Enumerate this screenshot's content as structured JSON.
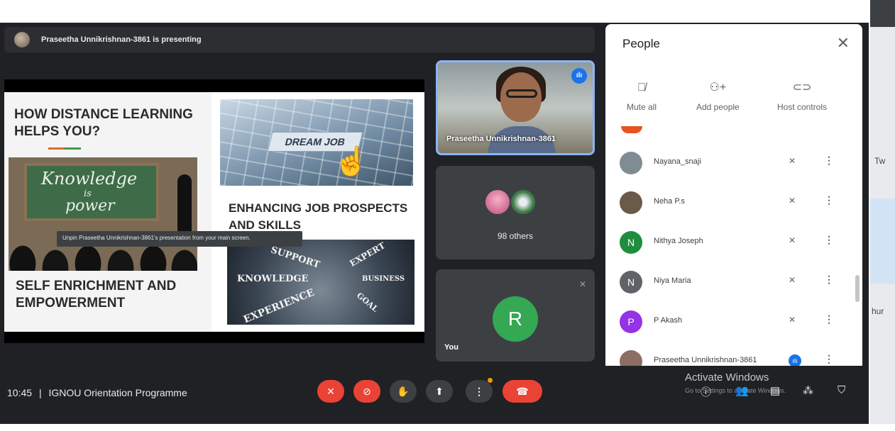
{
  "presenter_bar": {
    "text": "Praseetha Unnikrishnan-3861 is presenting"
  },
  "slide": {
    "heading_1": "HOW DISTANCE LEARNING HELPS YOU?",
    "board_word_1": "Knowledge",
    "board_word_2": "is",
    "board_word_3": "power",
    "heading_2": "SELF ENRICHMENT AND EMPOWERMENT",
    "keyboard_key": "DREAM JOB",
    "heading_3": "ENHANCING JOB PROSPECTS AND SKILLS",
    "biz_words": [
      "SUPPORT",
      "EXPERT",
      "KNOWLEDGE",
      "BUSINESS",
      "EXPERIENCE",
      "GOAL"
    ]
  },
  "tooltip": "Unpin Praseetha Unnikrishnan-3861's presentation from your main screen.",
  "tiles": {
    "presenter_name": "Praseetha Unnikrishnan-3861",
    "others_label": "98 others",
    "you_initial": "R",
    "you_label": "You"
  },
  "people_panel": {
    "title": "People",
    "controls": [
      "Mute all",
      "Add people",
      "Host controls"
    ],
    "participants": [
      {
        "name": "Nayana_snaji",
        "initial": "",
        "color": "#7f8c94"
      },
      {
        "name": "Neha P.s",
        "initial": "",
        "color": "#6a5a4a"
      },
      {
        "name": "Nithya Joseph",
        "initial": "N",
        "color": "#1e8e3e"
      },
      {
        "name": "Niya Maria",
        "initial": "N",
        "color": "#5f6368"
      },
      {
        "name": "P Akash",
        "initial": "P",
        "color": "#9334e6"
      },
      {
        "name": "Praseetha Unnikrishnan-3861",
        "initial": "",
        "color": "#8d6e63"
      }
    ]
  },
  "bottom_bar": {
    "time": "10:45",
    "separator": "|",
    "meeting_name": "IGNOU Orientation Programme"
  },
  "windows_watermark": {
    "line1": "Activate Windows",
    "line2": "Go to Settings to activate Windows."
  },
  "right_strip": {
    "text_1": "Tw",
    "text_2": "hur"
  }
}
